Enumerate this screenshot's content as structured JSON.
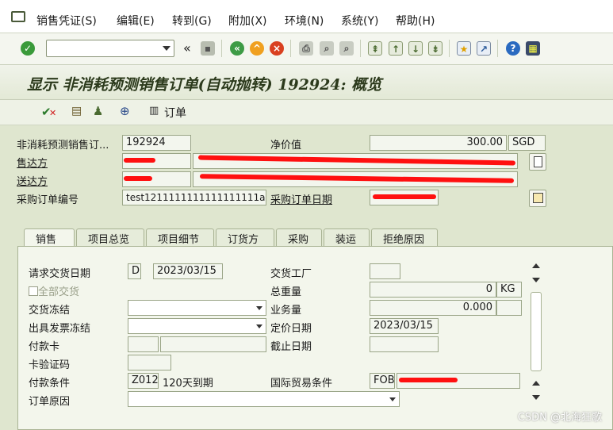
{
  "menubar": {
    "items": [
      "销售凭证(S)",
      "编辑(E)",
      "转到(G)",
      "附加(X)",
      "环境(N)",
      "系统(Y)",
      "帮助(H)"
    ]
  },
  "toolbar": {
    "command_value": "",
    "back_chevrons": "«"
  },
  "title": "显示 非消耗预测销售订单(自动抛转) 192924: 概览",
  "app_toolbar": {
    "order_label": "订单"
  },
  "header": {
    "doc_label": "非消耗预测销售订...",
    "doc_number": "192924",
    "net_value_label": "净价值",
    "net_value": "300.00",
    "currency": "SGD",
    "sold_to_label": "售达方",
    "ship_to_label": "送达方",
    "po_label": "采购订单编号",
    "po_value": "test1211111111111111111a...",
    "po_date_label": "采购订单日期"
  },
  "tabs": [
    "销售",
    "项目总览",
    "项目细节",
    "订货方",
    "采购",
    "装运",
    "拒绝原因"
  ],
  "sales_tab": {
    "req_delivery_label": "请求交货日期",
    "req_delivery_type": "D",
    "req_delivery_date": "2023/03/15",
    "complete_delivery_label": "全部交货",
    "delivery_block_label": "交货冻结",
    "billing_block_label": "出具发票冻结",
    "payment_card_label": "付款卡",
    "card_verif_label": "卡验证码",
    "payment_terms_label": "付款条件",
    "payment_terms_code": "Z012",
    "payment_terms_text": "120天到期",
    "order_reason_label": "订单原因",
    "delivering_plant_label": "交货工厂",
    "total_weight_label": "总重量",
    "total_weight": "0",
    "weight_unit": "KG",
    "volume_label": "业务量",
    "volume": "0.000",
    "pricing_date_label": "定价日期",
    "pricing_date": "2023/03/15",
    "expiry_date_label": "截止日期",
    "incoterms_label": "国际贸易条件",
    "incoterms": "FOB"
  },
  "watermark": "CSDN @北海狂歌",
  "colors": {
    "background": "#dfe6cf",
    "title_text": "#2c3a1c",
    "redaction": "#ff1010"
  }
}
